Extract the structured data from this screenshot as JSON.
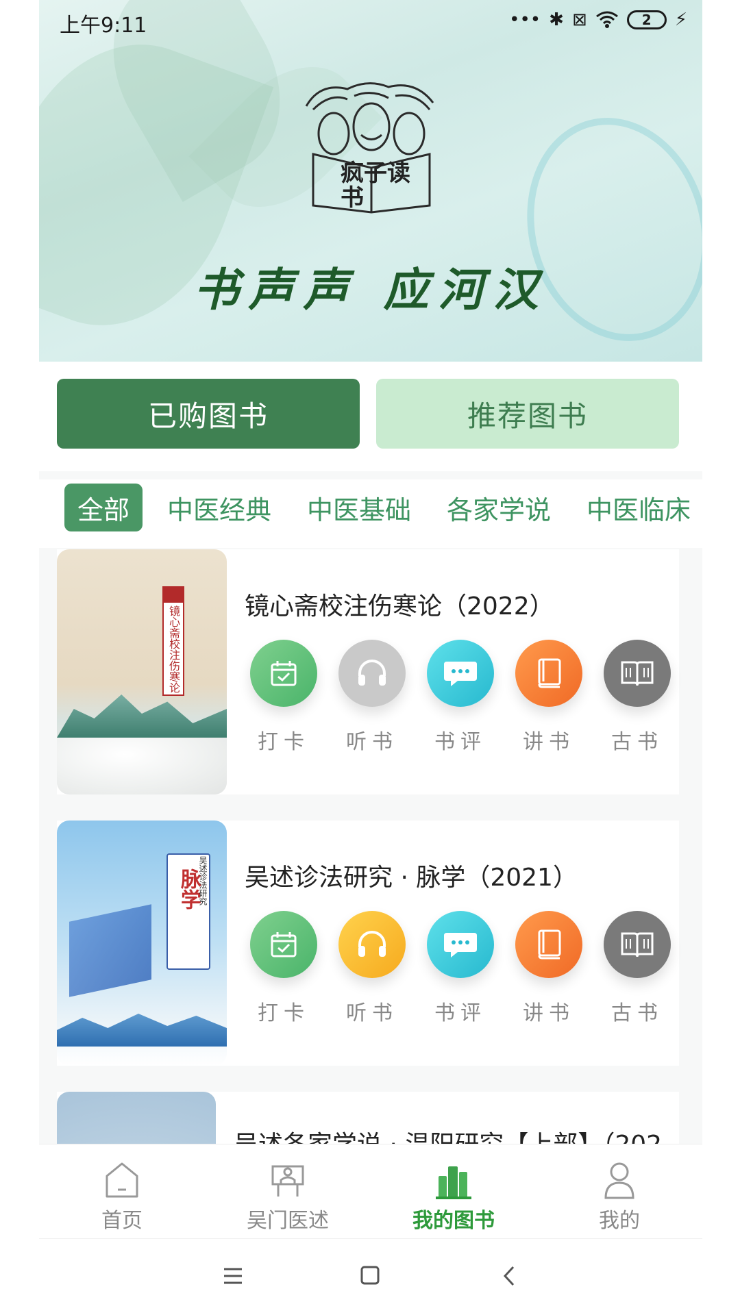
{
  "status_bar": {
    "time": "上午9:11",
    "battery": "2"
  },
  "banner": {
    "logo_text": "疯子读书",
    "slogan": "书声声 应河汉"
  },
  "segments": {
    "purchased": "已购图书",
    "recommend": "推荐图书"
  },
  "categories": [
    "全部",
    "中医经典",
    "中医基础",
    "各家学说",
    "中医临床"
  ],
  "books": [
    {
      "title": "镜心斋校注伤寒论（2022）",
      "cover_text": "镜心斋校注伤寒论",
      "listen_color": "#c9c9c9"
    },
    {
      "title": "吴述诊法研究 · 脉学（2021）",
      "cover_text": "脉学",
      "cover_sub": "吴述诊法研究",
      "listen_color": "#f6b32a"
    },
    {
      "title": "吴述各家学说 · 温阳研究【上部】（202"
    }
  ],
  "actions": [
    "打卡",
    "听书",
    "书评",
    "讲书",
    "古书"
  ],
  "nav": [
    "首页",
    "吴门医述",
    "我的图书",
    "我的"
  ],
  "colors": {
    "primary": "#3f8152",
    "accent": "#2e9a3b",
    "light": "#c9ebd0"
  }
}
